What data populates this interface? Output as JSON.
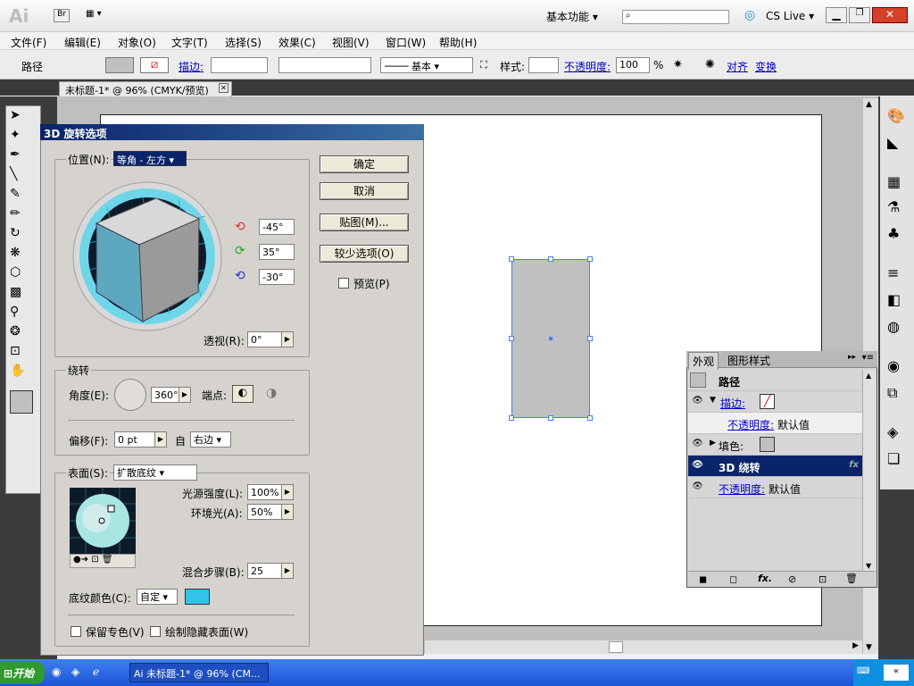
{
  "app": {
    "logo": "Ai",
    "bridge_label": "Br",
    "workspace_label": "基本功能",
    "search_placeholder": "",
    "cslive_label": "CS Live"
  },
  "menu": [
    "文件(F)",
    "编辑(E)",
    "对象(O)",
    "文字(T)",
    "选择(S)",
    "效果(C)",
    "视图(V)",
    "窗口(W)",
    "帮助(H)"
  ],
  "control_bar": {
    "object_type": "路径",
    "stroke_label": "描边:",
    "brush_label": "基本",
    "style_label": "样式:",
    "opacity_label": "不透明度:",
    "opacity_value": "100",
    "opacity_unit": "%",
    "align_label": "对齐",
    "transform_label": "变换"
  },
  "document_tab": "未标题-1* @ 96% (CMYK/预览)",
  "dialog": {
    "title": "3D 旋转选项",
    "position_label": "位置(N):",
    "position_value": "等角 - 左方",
    "rot_x": "-45°",
    "rot_y": "35°",
    "rot_z": "-30°",
    "perspective_label": "透视(R):",
    "perspective_value": "0°",
    "ok": "确定",
    "cancel": "取消",
    "map_art": "贴图(M)...",
    "fewer_options": "较少选项(O)",
    "preview": "预览(P)",
    "revolve_group": "绕转",
    "angle_label": "角度(E):",
    "angle_value": "360°",
    "cap_label": "端点:",
    "offset_label": "偏移(F):",
    "offset_value": "0 pt",
    "from_label": "自",
    "from_value": "右边",
    "surface_label": "表面(S):",
    "surface_value": "扩散底纹",
    "light_intensity_label": "光源强度(L):",
    "light_intensity_value": "100%",
    "ambient_label": "环境光(A):",
    "ambient_value": "50%",
    "blend_steps_label": "混合步骤(B):",
    "blend_steps_value": "25",
    "shade_color_label": "底纹颜色(C):",
    "shade_color_value": "自定",
    "shade_color": "#33c3e8",
    "preserve_spot": "保留专色(V)",
    "draw_hidden": "绘制隐藏表面(W)"
  },
  "appearance_panel": {
    "tabs": [
      "外观",
      "图形样式"
    ],
    "object": "路径",
    "rows": [
      {
        "label": "描边:",
        "link": true
      },
      {
        "label": "不透明度:",
        "value": "默认值",
        "link": true
      },
      {
        "label": "填色:",
        "link": false
      },
      {
        "label": "3D 绕转",
        "link": false,
        "selected": true
      },
      {
        "label": "不透明度:",
        "value": "默认值",
        "link": true
      }
    ]
  },
  "taskbar": {
    "start": "开始",
    "task": "未标题-1* @ 96% (CM..."
  },
  "colors": {
    "accent": "#0a246a",
    "selection": "#4a7cf5",
    "rect_fill": "#c0c0c0"
  }
}
